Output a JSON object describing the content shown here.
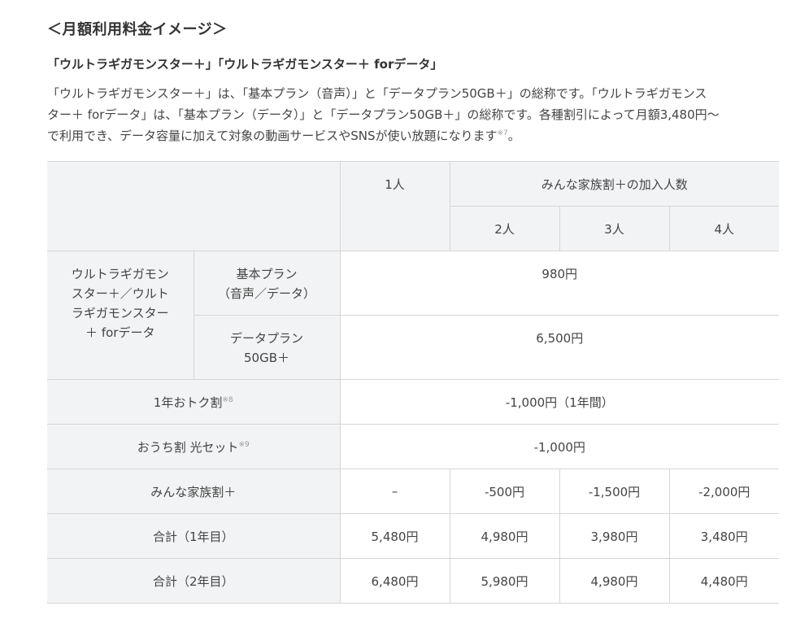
{
  "heading": "＜月額利用料金イメージ＞",
  "subheading": "「ウルトラギガモンスター＋」「ウルトラギガモンスター＋ forデータ」",
  "intro": {
    "line1": "「ウルトラギガモンスター＋」は、「基本プラン（音声）」と「データプラン50GB＋」の総称です。「ウルトラギガモンス",
    "line2": "ター＋ forデータ」は、「基本プラン（データ）」と「データプラン50GB＋」の総称です。各種割引によって月額3,480円～",
    "line3": "で利用でき、データ容量に加えて対象の動画サービスやSNSが使い放題になります",
    "note": "※7",
    "end": "。"
  },
  "table": {
    "header": {
      "one_person": "1人",
      "family_group": "みんな家族割＋の加入人数",
      "two": "2人",
      "three": "3人",
      "four": "4人"
    },
    "plan_group": {
      "line1": "ウルトラギガモン",
      "line2": "スター＋／ウルト",
      "line3": "ラギガモンスター",
      "line4": "＋ forデータ"
    },
    "basic_plan": {
      "line1": "基本プラン",
      "line2": "（音声／データ）",
      "value": "980円"
    },
    "data_plan": {
      "line1": "データプラン",
      "line2": "50GB＋",
      "value": "6,500円"
    },
    "year_discount": {
      "label": "1年おトク割",
      "note": "※8",
      "value": "-1,000円（1年間）"
    },
    "home_discount": {
      "label": "おうち割 光セット",
      "note": "※9",
      "value": "-1,000円"
    },
    "family_discount": {
      "label": "みんな家族割＋",
      "values": [
        "–",
        "-500円",
        "-1,500円",
        "-2,000円"
      ]
    },
    "total_year1": {
      "label": "合計（1年目）",
      "values": [
        "5,480円",
        "4,980円",
        "3,980円",
        "3,480円"
      ]
    },
    "total_year2": {
      "label": "合計（2年目）",
      "values": [
        "6,480円",
        "5,980円",
        "4,980円",
        "4,480円"
      ]
    }
  }
}
